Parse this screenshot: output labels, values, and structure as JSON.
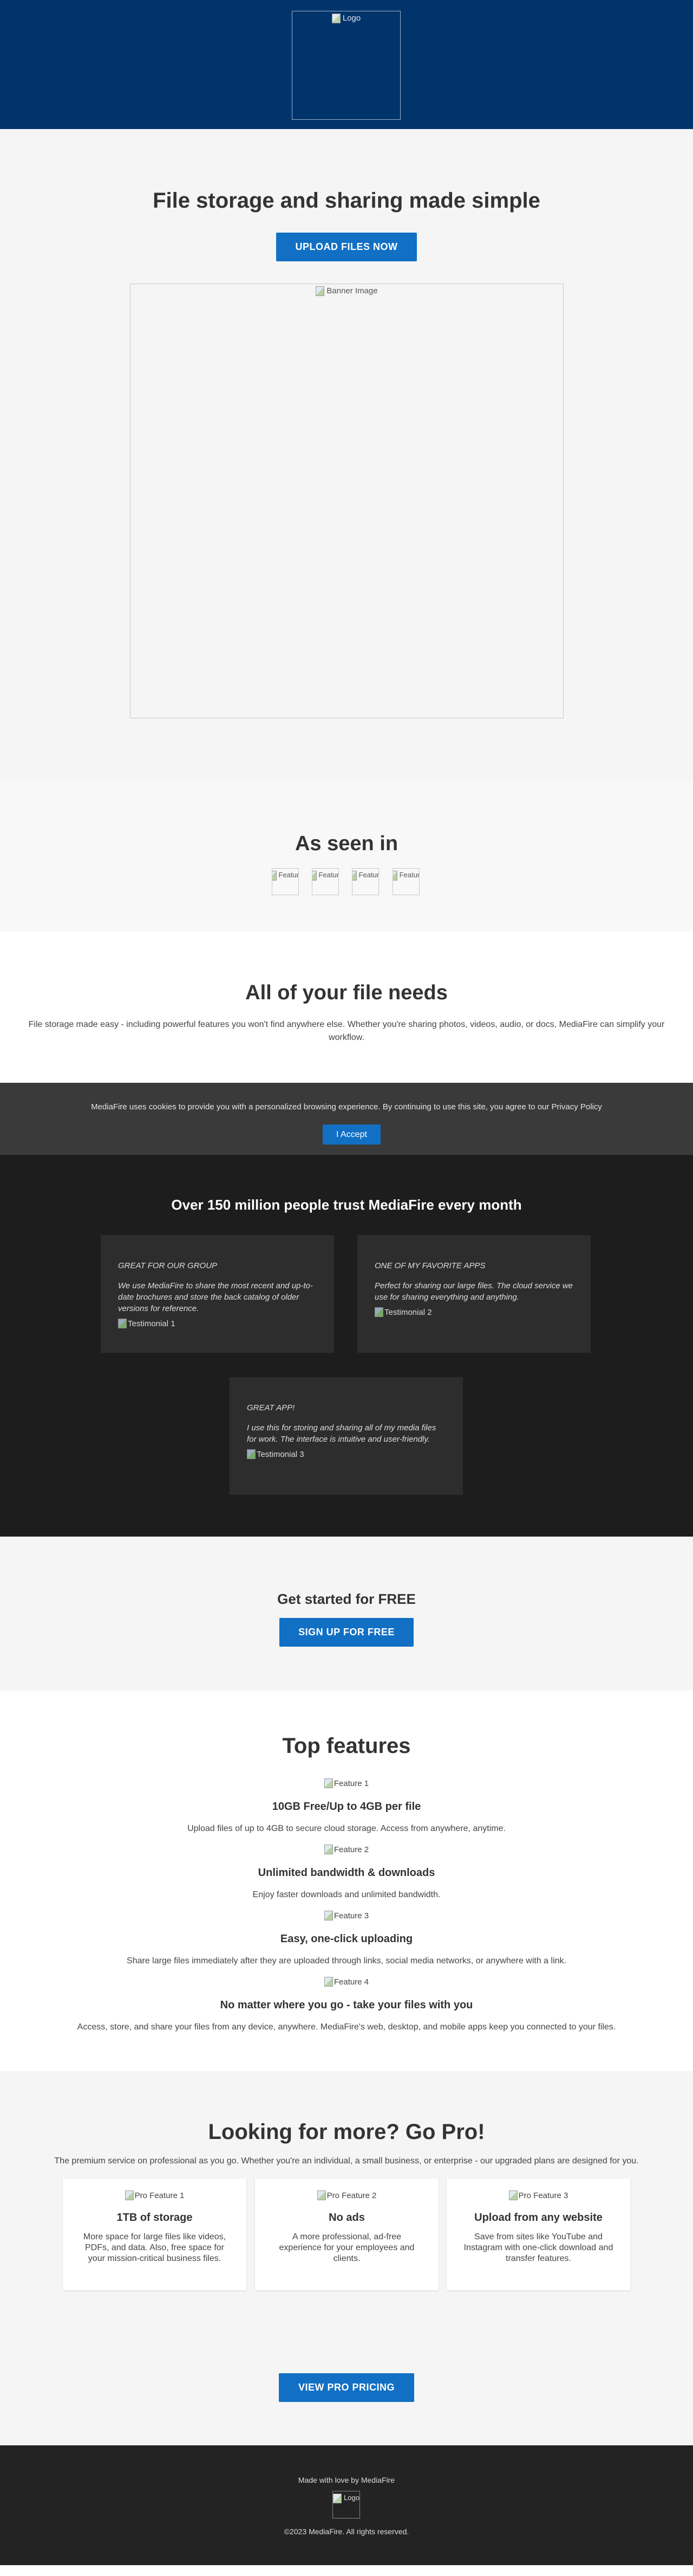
{
  "header": {
    "logo_alt": "Logo"
  },
  "hero": {
    "title": "File storage and sharing made simple",
    "button": "UPLOAD FILES NOW",
    "banner_alt": "Banner Image"
  },
  "seen_in": {
    "title": "As seen in",
    "logos": [
      "Feature",
      "Feature",
      "Feature",
      "Feature"
    ]
  },
  "file_needs": {
    "title": "All of your file needs",
    "text": "File storage made easy - including powerful features you won't find anywhere else. Whether you're sharing photos, videos, audio, or docs, MediaFire can simplify your workflow."
  },
  "cookie": {
    "text": "MediaFire uses cookies to provide you with a personalized browsing experience. By continuing to use this site, you agree to our Privacy Policy",
    "button": "I Accept"
  },
  "trust": {
    "title": "Over 150 million people trust MediaFire every month",
    "testimonials": [
      {
        "name": "GREAT FOR OUR GROUP",
        "quote": "We use MediaFire to share the most recent and up-to-date brochures and store the back catalog of older versions for reference.",
        "img_alt": "Testimonial 1"
      },
      {
        "name": "ONE OF MY FAVORITE APPS",
        "quote": "Perfect for sharing our large files. The cloud service we use for sharing everything and anything.",
        "img_alt": "Testimonial 2"
      },
      {
        "name": "GREAT APP!",
        "quote": "I use this for storing and sharing all of my media files for work. The interface is intuitive and user-friendly.",
        "img_alt": "Testimonial 3"
      }
    ]
  },
  "get_started": {
    "title": "Get started for FREE",
    "button": "SIGN UP FOR FREE"
  },
  "top_features": {
    "title": "Top features",
    "items": [
      {
        "img_alt": "Feature 1",
        "title": "10GB Free/Up to 4GB per file",
        "text": "Upload files of up to 4GB to secure cloud storage. Access from anywhere, anytime."
      },
      {
        "img_alt": "Feature 2",
        "title": "Unlimited bandwidth & downloads",
        "text": "Enjoy faster downloads and unlimited bandwidth."
      },
      {
        "img_alt": "Feature 3",
        "title": "Easy, one-click uploading",
        "text": "Share large files immediately after they are uploaded through links, social media networks, or anywhere with a link."
      },
      {
        "img_alt": "Feature 4",
        "title": "No matter where you go - take your files with you",
        "text": "Access, store, and share your files from any device, anywhere. MediaFire's web, desktop, and mobile apps keep you connected to your files."
      }
    ]
  },
  "pro": {
    "title": "Looking for more? Go Pro!",
    "text": "The premium service on professional as you go. Whether you're an individual, a small business, or enterprise - our upgraded plans are designed for you.",
    "cards": [
      {
        "img_alt": "Pro Feature 1",
        "title": "1TB of storage",
        "text": "More space for large files like videos, PDFs, and data. Also, free space for your mission-critical business files."
      },
      {
        "img_alt": "Pro Feature 2",
        "title": "No ads",
        "text": "A more professional, ad-free experience for your employees and clients."
      },
      {
        "img_alt": "Pro Feature 3",
        "title": "Upload from any website",
        "text": "Save from sites like YouTube and Instagram with one-click download and transfer features."
      }
    ]
  },
  "pricing": {
    "button": "VIEW PRO PRICING"
  },
  "footer": {
    "made_with": "Made with love by MediaFire",
    "logo_alt": "Logo",
    "copyright": "©2023 MediaFire. All rights reserved."
  },
  "colors": {
    "header_bg": "#00346b",
    "accent_blue": "#1170c4",
    "dark_section": "#1d1d1d",
    "card_dark": "#2d2d2d",
    "cookie_bg": "#3a3a3a",
    "footer_bg": "#232323"
  }
}
